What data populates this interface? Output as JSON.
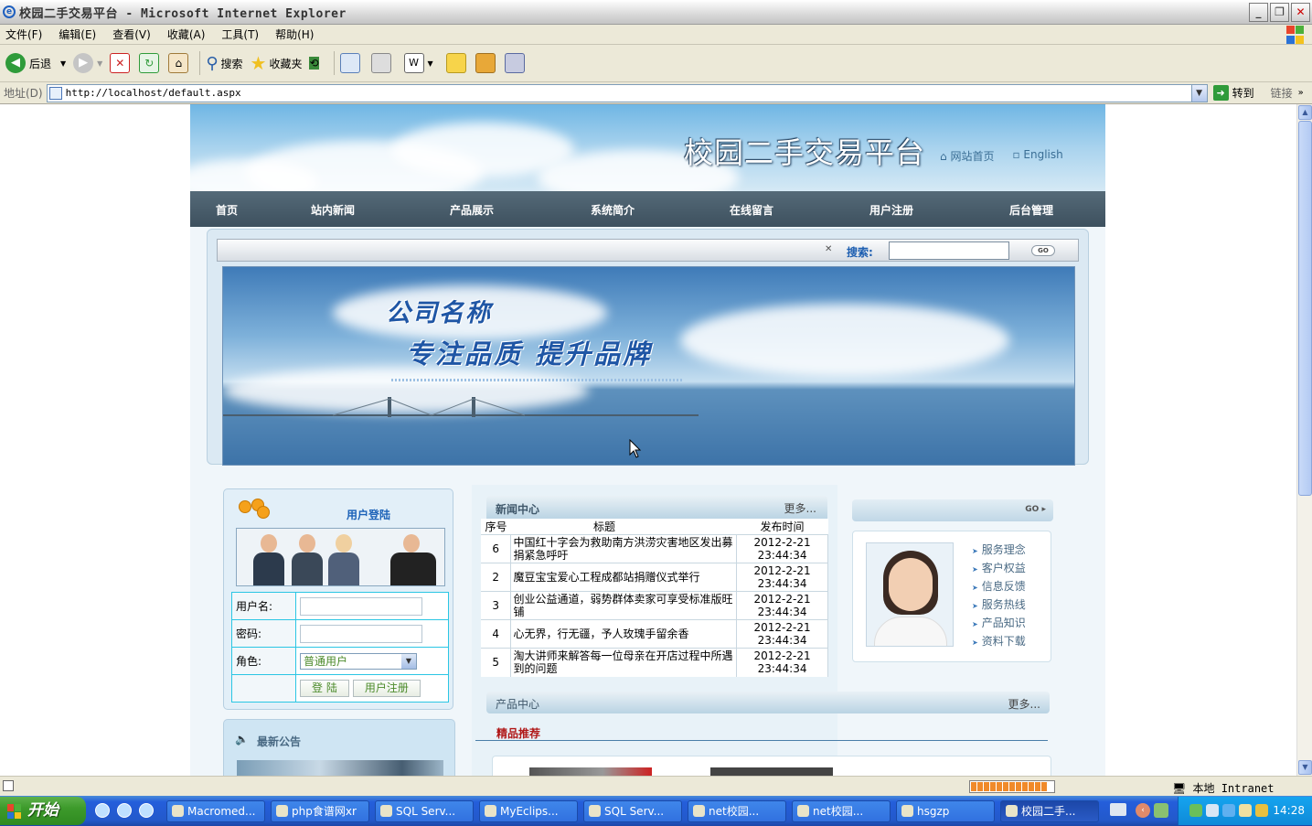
{
  "window": {
    "title": "校园二手交易平台 - Microsoft Internet Explorer"
  },
  "menu": [
    "文件(F)",
    "编辑(E)",
    "查看(V)",
    "收藏(A)",
    "工具(T)",
    "帮助(H)"
  ],
  "toolbar": {
    "back": "后退",
    "search": "搜索",
    "favorites": "收藏夹"
  },
  "address": {
    "label": "地址(D)",
    "url": "http://localhost/default.aspx",
    "go": "转到",
    "links": "链接"
  },
  "site": {
    "title": "校园二手交易平台",
    "home_link": "网站首页",
    "english_link": "English",
    "nav": [
      "首页",
      "站内新闻",
      "产品展示",
      "系统简介",
      "在线留言",
      "用户注册",
      "后台管理"
    ],
    "search_label": "搜索:",
    "search_go": "GO",
    "banner_line1": "公司名称",
    "banner_line2": "专注品质 提升品牌"
  },
  "login": {
    "title": "用户登陆",
    "username_label": "用户名:",
    "password_label": "密码:",
    "role_label": "角色:",
    "role_value": "普通用户",
    "login_button": "登 陆",
    "register_button": "用户注册"
  },
  "notice": {
    "title": "最新公告"
  },
  "news": {
    "title": "新闻中心",
    "more": "更多...",
    "columns": [
      "序号",
      "标题",
      "发布时间"
    ],
    "rows": [
      {
        "no": "6",
        "title": "中国红十字会为救助南方洪涝灾害地区发出募捐紧急呼吁",
        "date": "2012-2-21",
        "time": "23:44:34"
      },
      {
        "no": "2",
        "title": "魔豆宝宝爱心工程成都站捐赠仪式举行",
        "date": "2012-2-21",
        "time": "23:44:34"
      },
      {
        "no": "3",
        "title": "创业公益通道，弱势群体卖家可享受标准版旺铺",
        "date": "2012-2-21",
        "time": "23:44:34"
      },
      {
        "no": "4",
        "title": "心无界，行无疆，予人玫瑰手留余香",
        "date": "2012-2-21",
        "time": "23:44:34"
      },
      {
        "no": "5",
        "title": "淘大讲师来解答每一位母亲在开店过程中所遇到的问题",
        "date": "2012-2-21",
        "time": "23:44:34"
      }
    ]
  },
  "products": {
    "title": "产品中心",
    "more": "更多...",
    "featured": "精品推荐"
  },
  "service": {
    "go": "GO",
    "items": [
      "服务理念",
      "客户权益",
      "信息反馈",
      "服务热线",
      "产品知识",
      "资料下载"
    ]
  },
  "statusbar": {
    "zone": "本地 Intranet"
  },
  "taskbar": {
    "start": "开始",
    "tasks": [
      "Macromed...",
      "php食谱网xr",
      "SQL Serv...",
      "MyEclips...",
      "SQL Serv...",
      "net校园...",
      "net校园...",
      "hsgzp",
      "校园二手..."
    ],
    "clock": "14:28"
  }
}
